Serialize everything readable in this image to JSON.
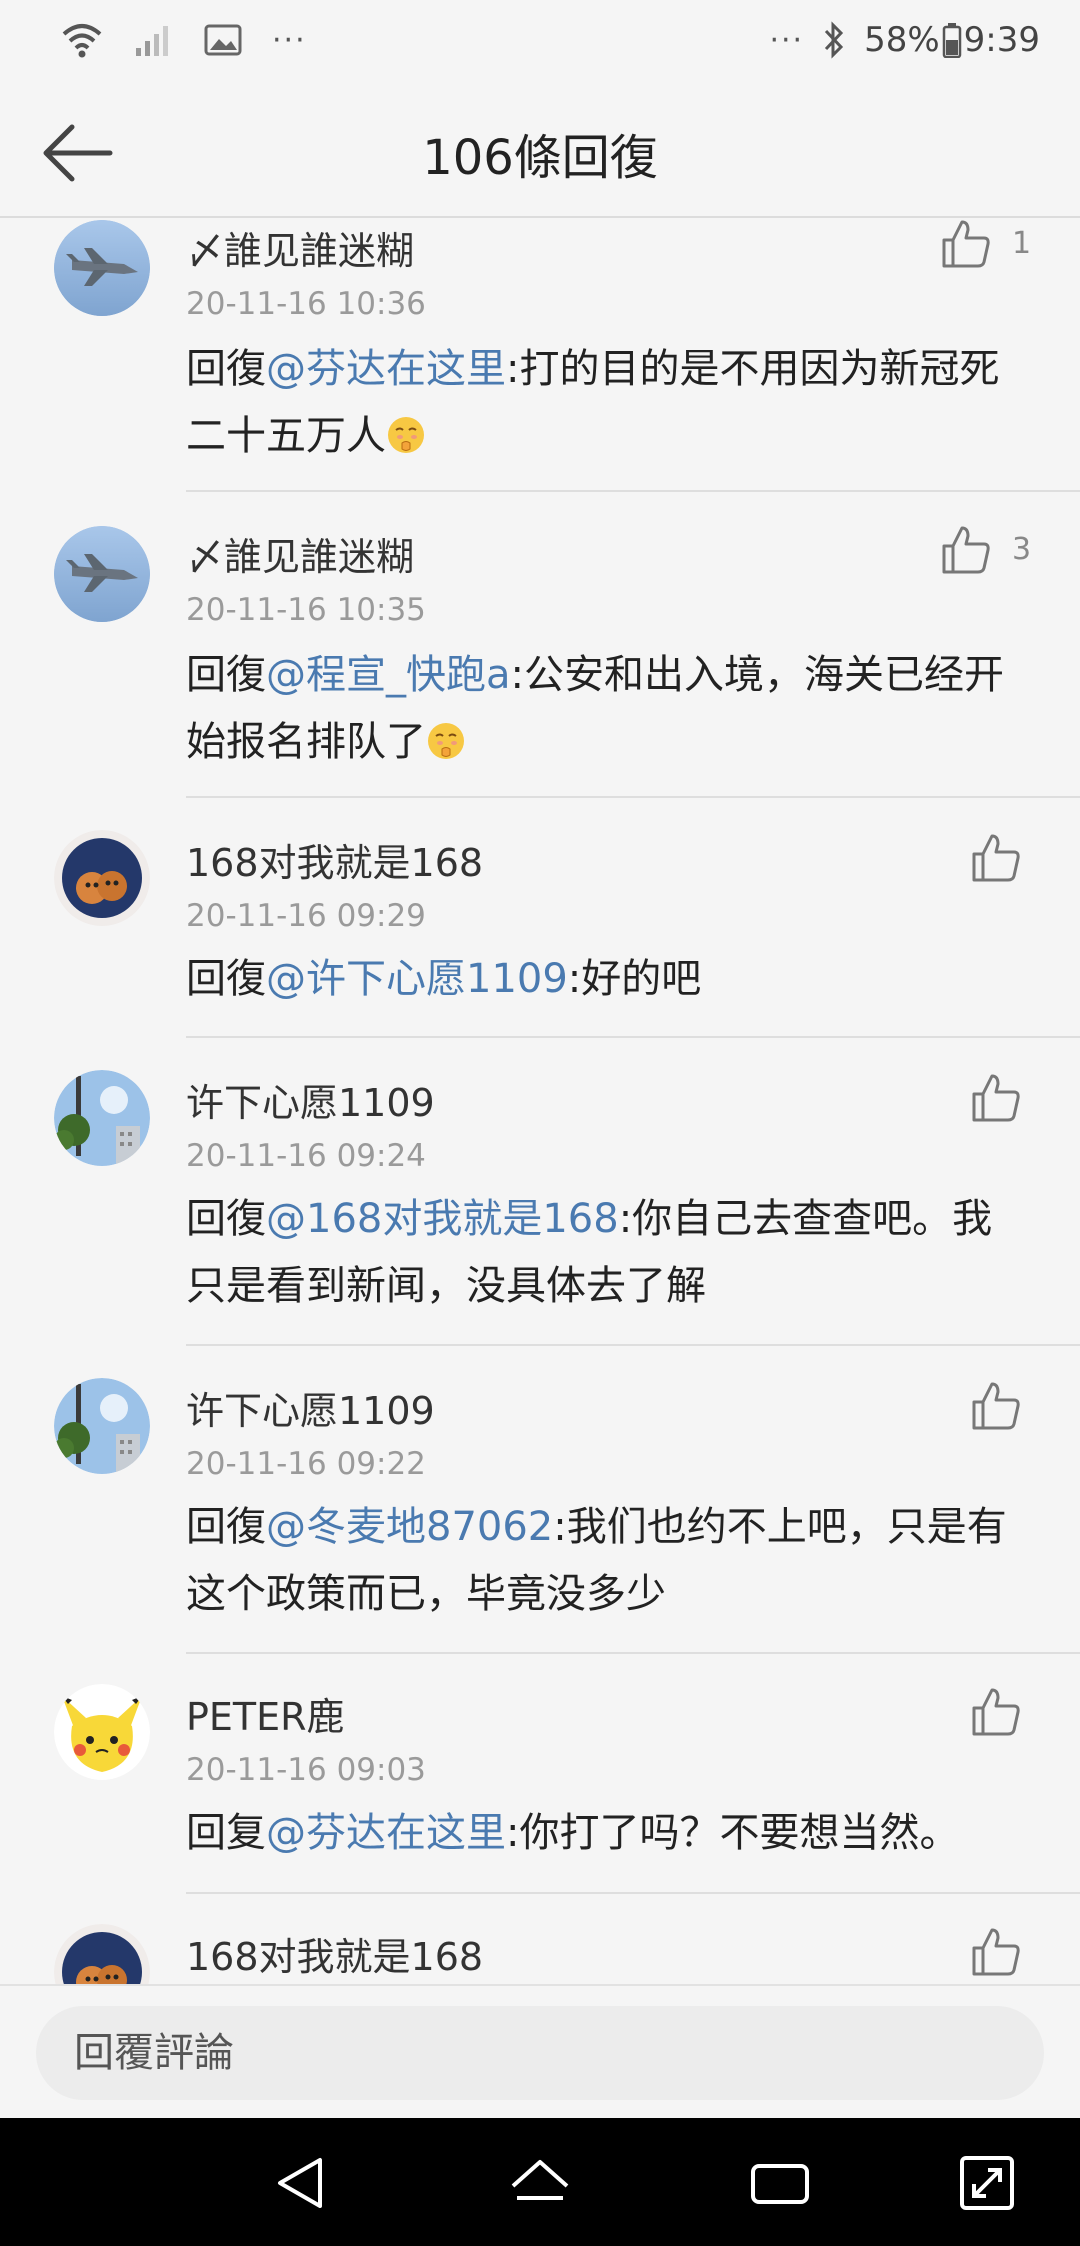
{
  "status_bar": {
    "left_icons": [
      "wifi-icon",
      "signal-icon",
      "gallery-icon"
    ],
    "left_more": "···",
    "right_more": "···",
    "battery": "58%",
    "time": "9:39"
  },
  "header": {
    "title": "106條回復"
  },
  "comments": [
    {
      "username": "〆誰见誰迷糊",
      "time": "20-11-16 10:36",
      "like_count": "1",
      "prefix": "回復",
      "mention": "@芬达在这里",
      "text": ":打的目的是不用因为新冠死二十五万人",
      "has_emoji": true,
      "avatar": "jet-avatar"
    },
    {
      "username": "〆誰见誰迷糊",
      "time": "20-11-16 10:35",
      "like_count": "3",
      "prefix": "回復",
      "mention": "@程宣_快跑a",
      "text": ":公安和出入境，海关已经开始报名排队了",
      "has_emoji": true,
      "avatar": "jet-avatar"
    },
    {
      "username": "168对我就是168",
      "time": "20-11-16 09:29",
      "like_count": "",
      "prefix": "回復",
      "mention": "@许下心愿1109",
      "text": ":好的吧",
      "has_emoji": false,
      "avatar": "cat-avatar"
    },
    {
      "username": "许下心愿1109",
      "time": "20-11-16 09:24",
      "like_count": "",
      "prefix": "回復",
      "mention": "@168对我就是168",
      "text": ":你自己去查查吧。我只是看到新闻，没具体去了解",
      "has_emoji": false,
      "avatar": "city-avatar"
    },
    {
      "username": "许下心愿1109",
      "time": "20-11-16 09:22",
      "like_count": "",
      "prefix": "回復",
      "mention": "@冬麦地87062",
      "text": ":我们也约不上吧，只是有这个政策而已，毕竟没多少",
      "has_emoji": false,
      "avatar": "city-avatar"
    },
    {
      "username": "PETER鹿",
      "time": "20-11-16 09:03",
      "like_count": "",
      "prefix": "回复",
      "mention": "@芬达在这里",
      "text": ":你打了吗？不要想当然。",
      "has_emoji": false,
      "avatar": "pikachu-avatar"
    },
    {
      "username": "168对我就是168",
      "time": "",
      "like_count": "",
      "prefix": "",
      "mention": "",
      "text": "",
      "has_emoji": false,
      "avatar": "cat-avatar"
    }
  ],
  "reply_bar": {
    "placeholder": "回覆評論"
  },
  "nav_bar": {
    "buttons": [
      "back-nav-icon",
      "home-nav-icon",
      "recents-nav-icon",
      "expand-nav-icon"
    ]
  }
}
